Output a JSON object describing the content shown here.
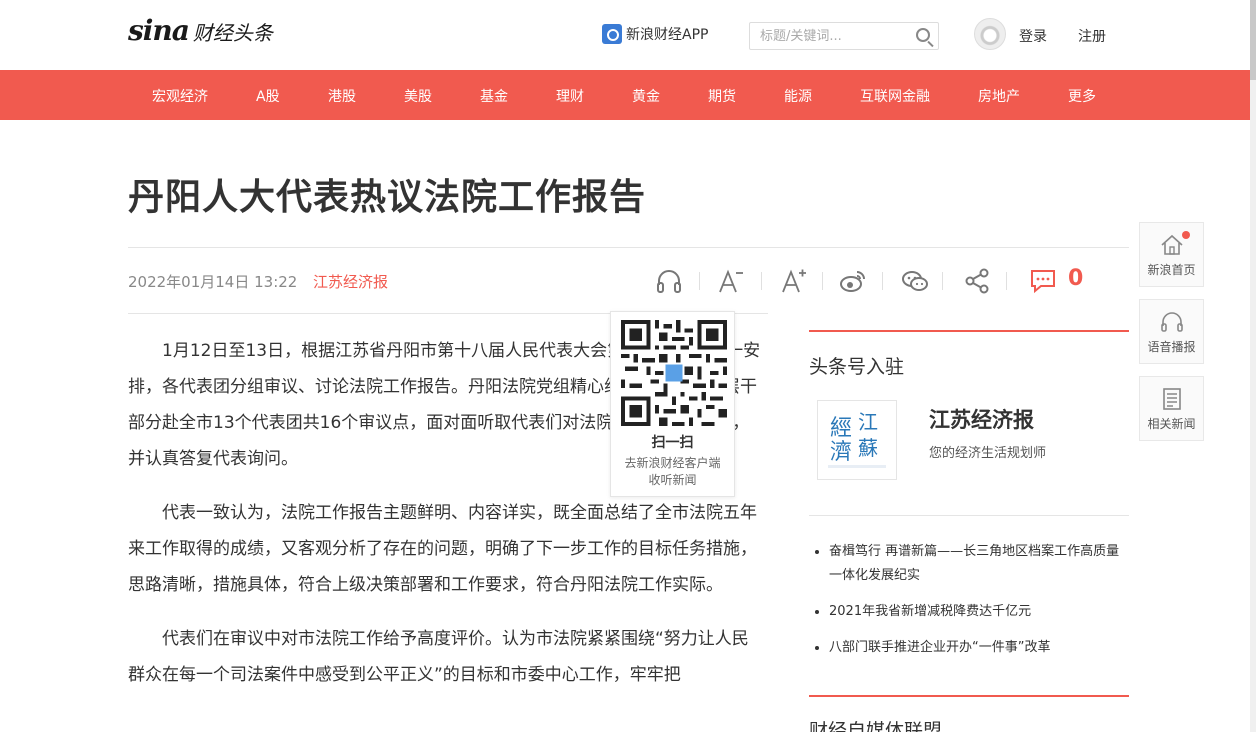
{
  "header": {
    "logo_text": "sina",
    "logo_sub": "财经头条",
    "app_link": "新浪财经APP",
    "search_placeholder": "标题/关键词...",
    "login": "登录",
    "register": "注册"
  },
  "nav": {
    "items": [
      "宏观经济",
      "A股",
      "港股",
      "美股",
      "基金",
      "理财",
      "黄金",
      "期货",
      "能源",
      "互联网金融",
      "房地产",
      "更多"
    ]
  },
  "article": {
    "title": "丹阳人大代表热议法院工作报告",
    "date": "2022年01月14日 13:22",
    "source": "江苏经济报",
    "comment_count": "0",
    "paragraphs": [
      "1月12日至13日，根据江苏省丹阳市第十八届人民代表大会第一次会议程统一安排，各代表团分组审议、讨论法院工作报告。丹阳法院党组精心组织院领导和中层干部分赴全市13个代表团共16个审议点，面对面听取代表们对法院工作的意见建议，并认真答复代表询问。",
      "代表一致认为，法院工作报告主题鲜明、内容详实，既全面总结了全市法院五年来工作取得的成绩，又客观分析了存在的问题，明确了下一步工作的目标任务措施，思路清晰，措施具体，符合上级决策部署和工作要求，符合丹阳法院工作实际。",
      "代表们在审议中对市法院工作给予高度评价。认为市法院紧紧围绕“努力让人民群众在每一个司法案件中感受到公平正义”的目标和市委中心工作，牢牢把"
    ]
  },
  "qr_popup": {
    "title": "扫一扫",
    "line1": "去新浪财经客户端",
    "line2": "收听新闻"
  },
  "sidebar": {
    "section_title": "头条号入驻",
    "account_name": "江苏经济报",
    "account_desc": "您的经济生活规划师",
    "news": [
      "奋楫笃行 再谱新篇——长三角地区档案工作高质量一体化发展纪实",
      "2021年我省新增减税降费达千亿元",
      "八部门联手推进企业开办“一件事”改革"
    ],
    "section_title2": "财经自媒体联盟"
  },
  "float_tools": {
    "home": "新浪首页",
    "audio": "语音播报",
    "related": "相关新闻"
  },
  "colors": {
    "accent": "#f15a4f"
  }
}
